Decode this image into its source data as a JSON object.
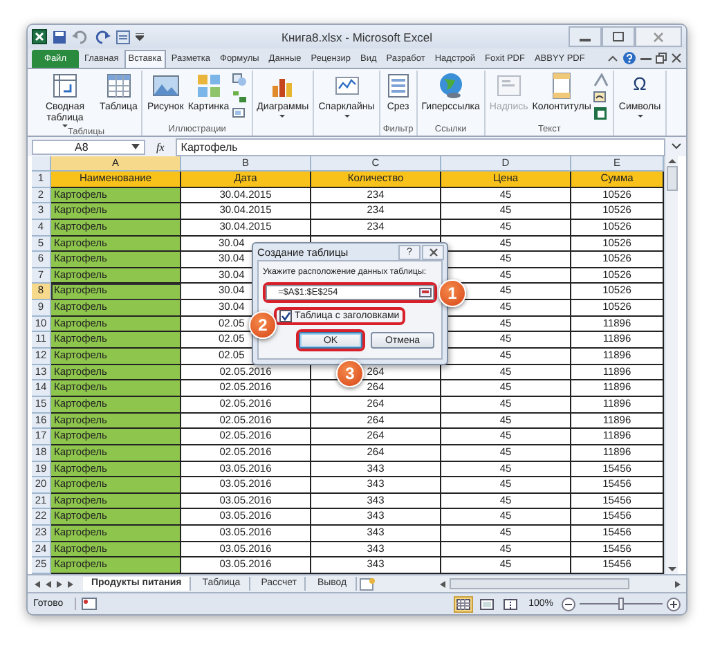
{
  "window": {
    "title": "Книга8.xlsx - Microsoft Excel"
  },
  "ribbon_tabs": [
    {
      "label": "Файл",
      "kind": "file",
      "selected": false
    },
    {
      "label": "Главная",
      "kind": "tab",
      "selected": false
    },
    {
      "label": "Вставка",
      "kind": "tab",
      "selected": true
    },
    {
      "label": "Разметка",
      "kind": "tab",
      "selected": false
    },
    {
      "label": "Формулы",
      "kind": "tab",
      "selected": false
    },
    {
      "label": "Данные",
      "kind": "tab",
      "selected": false
    },
    {
      "label": "Рецензир",
      "kind": "tab",
      "selected": false
    },
    {
      "label": "Вид",
      "kind": "tab",
      "selected": false
    },
    {
      "label": "Разработ",
      "kind": "tab",
      "selected": false
    },
    {
      "label": "Надстрой",
      "kind": "tab",
      "selected": false
    },
    {
      "label": "Foxit PDF",
      "kind": "tab",
      "selected": false
    },
    {
      "label": "ABBYY PDF",
      "kind": "tab",
      "selected": false
    }
  ],
  "ribbon_groups": [
    {
      "label": "Таблицы",
      "buttons": [
        {
          "kind": "large",
          "label": "Сводная таблица",
          "dropdown": true,
          "disabled": false
        },
        {
          "kind": "large",
          "label": "Таблица",
          "dropdown": false,
          "disabled": false
        }
      ]
    },
    {
      "label": "Иллюстрации",
      "buttons": [
        {
          "kind": "large",
          "label": "Рисунок",
          "dropdown": false,
          "disabled": false
        },
        {
          "kind": "large",
          "label": "Картинка",
          "dropdown": false,
          "disabled": false
        },
        {
          "kind": "stack"
        }
      ]
    },
    {
      "buttons": [
        {
          "kind": "large",
          "label": "Диаграммы",
          "dropdown": true,
          "disabled": false
        }
      ]
    },
    {
      "buttons": [
        {
          "kind": "large",
          "label": "Спарклайны",
          "dropdown": true,
          "disabled": false
        }
      ]
    },
    {
      "label": "Фильтр",
      "buttons": [
        {
          "kind": "large",
          "label": "Срез",
          "dropdown": false,
          "disabled": false
        }
      ]
    },
    {
      "label": "Ссылки",
      "buttons": [
        {
          "kind": "large",
          "label": "Гиперссылка",
          "dropdown": false,
          "disabled": false
        }
      ]
    },
    {
      "label": "Текст",
      "buttons": [
        {
          "kind": "large",
          "label": "Надпись",
          "dropdown": false,
          "disabled": true
        },
        {
          "kind": "large",
          "label": "Колонтитулы",
          "dropdown": false,
          "disabled": false
        },
        {
          "kind": "stack"
        }
      ]
    },
    {
      "buttons": [
        {
          "kind": "glyph",
          "label": "Символы",
          "glyph": "Ω",
          "dropdown": true,
          "disabled": false
        }
      ]
    }
  ],
  "formula_bar": {
    "name_box": "A8",
    "function_label": "fx",
    "formula": "Картофель"
  },
  "columns": [
    {
      "label": "A",
      "selected": true
    },
    {
      "label": "B",
      "selected": false
    },
    {
      "label": "C",
      "selected": false
    },
    {
      "label": "D",
      "selected": false
    },
    {
      "label": "E",
      "selected": false
    }
  ],
  "rows": [
    {
      "number": "1",
      "kind": "header",
      "selected": false,
      "cells": [
        {
          "kind": "text",
          "text": "Наименование"
        },
        {
          "kind": "text",
          "text": "Дата"
        },
        {
          "kind": "text",
          "text": "Количество"
        },
        {
          "kind": "text",
          "text": "Цена"
        },
        {
          "kind": "text",
          "text": "Сумма"
        }
      ]
    },
    {
      "number": "2",
      "kind": "data",
      "selected": false,
      "cells": [
        {
          "kind": "text",
          "text": "Картофель"
        },
        {
          "kind": "text",
          "text": "30.04.2015"
        },
        {
          "kind": "text",
          "text": "234"
        },
        {
          "kind": "text",
          "text": "45"
        },
        {
          "kind": "text",
          "text": "10526"
        }
      ]
    },
    {
      "number": "3",
      "kind": "data",
      "selected": false,
      "cells": [
        {
          "kind": "text",
          "text": "Картофель"
        },
        {
          "kind": "text",
          "text": "30.04.2015"
        },
        {
          "kind": "text",
          "text": "234"
        },
        {
          "kind": "text",
          "text": "45"
        },
        {
          "kind": "text",
          "text": "10526"
        }
      ]
    },
    {
      "number": "4",
      "kind": "data",
      "selected": false,
      "cells": [
        {
          "kind": "text",
          "text": "Картофель"
        },
        {
          "kind": "text",
          "text": "30.04.2015"
        },
        {
          "kind": "text",
          "text": "234"
        },
        {
          "kind": "text",
          "text": "45"
        },
        {
          "kind": "text",
          "text": "10526"
        }
      ]
    },
    {
      "number": "5",
      "kind": "data",
      "selected": false,
      "cells": [
        {
          "kind": "text",
          "text": "Картофель"
        },
        {
          "kind": "partial",
          "text": "30.04"
        },
        {
          "kind": "covered"
        },
        {
          "kind": "text",
          "text": "45"
        },
        {
          "kind": "text",
          "text": "10526"
        }
      ]
    },
    {
      "number": "6",
      "kind": "data",
      "selected": false,
      "cells": [
        {
          "kind": "text",
          "text": "Картофель"
        },
        {
          "kind": "partial",
          "text": "30.04"
        },
        {
          "kind": "covered"
        },
        {
          "kind": "text",
          "text": "45"
        },
        {
          "kind": "text",
          "text": "10526"
        }
      ]
    },
    {
      "number": "7",
      "kind": "data",
      "selected": false,
      "cells": [
        {
          "kind": "text",
          "text": "Картофель"
        },
        {
          "kind": "partial",
          "text": "30.04"
        },
        {
          "kind": "covered"
        },
        {
          "kind": "text",
          "text": "45"
        },
        {
          "kind": "text",
          "text": "10526"
        }
      ]
    },
    {
      "number": "8",
      "kind": "data",
      "selected": true,
      "cells": [
        {
          "kind": "text",
          "text": "Картофель"
        },
        {
          "kind": "partial",
          "text": "30.04"
        },
        {
          "kind": "covered"
        },
        {
          "kind": "text",
          "text": "45"
        },
        {
          "kind": "text",
          "text": "10526"
        }
      ]
    },
    {
      "number": "9",
      "kind": "data",
      "selected": false,
      "cells": [
        {
          "kind": "text",
          "text": "Картофель"
        },
        {
          "kind": "partial",
          "text": "30.04"
        },
        {
          "kind": "covered"
        },
        {
          "kind": "text",
          "text": "45"
        },
        {
          "kind": "text",
          "text": "10526"
        }
      ]
    },
    {
      "number": "10",
      "kind": "data",
      "selected": false,
      "cells": [
        {
          "kind": "text",
          "text": "Картофель"
        },
        {
          "kind": "partial",
          "text": "02.05"
        },
        {
          "kind": "covered"
        },
        {
          "kind": "text",
          "text": "45"
        },
        {
          "kind": "text",
          "text": "11896"
        }
      ]
    },
    {
      "number": "11",
      "kind": "data",
      "selected": false,
      "cells": [
        {
          "kind": "text",
          "text": "Картофель"
        },
        {
          "kind": "partial",
          "text": "02.05"
        },
        {
          "kind": "covered"
        },
        {
          "kind": "text",
          "text": "45"
        },
        {
          "kind": "text",
          "text": "11896"
        }
      ]
    },
    {
      "number": "12",
      "kind": "data",
      "selected": false,
      "cells": [
        {
          "kind": "text",
          "text": "Картофель"
        },
        {
          "kind": "partial",
          "text": "02.05"
        },
        {
          "kind": "covered"
        },
        {
          "kind": "text",
          "text": "45"
        },
        {
          "kind": "text",
          "text": "11896"
        }
      ]
    },
    {
      "number": "13",
      "kind": "data",
      "selected": false,
      "cells": [
        {
          "kind": "text",
          "text": "Картофель"
        },
        {
          "kind": "text",
          "text": "02.05.2016"
        },
        {
          "kind": "text",
          "text": "264"
        },
        {
          "kind": "text",
          "text": "45"
        },
        {
          "kind": "text",
          "text": "11896"
        }
      ]
    },
    {
      "number": "14",
      "kind": "data",
      "selected": false,
      "cells": [
        {
          "kind": "text",
          "text": "Картофель"
        },
        {
          "kind": "text",
          "text": "02.05.2016"
        },
        {
          "kind": "text",
          "text": "264"
        },
        {
          "kind": "text",
          "text": "45"
        },
        {
          "kind": "text",
          "text": "11896"
        }
      ]
    },
    {
      "number": "15",
      "kind": "data",
      "selected": false,
      "cells": [
        {
          "kind": "text",
          "text": "Картофель"
        },
        {
          "kind": "text",
          "text": "02.05.2016"
        },
        {
          "kind": "text",
          "text": "264"
        },
        {
          "kind": "text",
          "text": "45"
        },
        {
          "kind": "text",
          "text": "11896"
        }
      ]
    },
    {
      "number": "16",
      "kind": "data",
      "selected": false,
      "cells": [
        {
          "kind": "text",
          "text": "Картофель"
        },
        {
          "kind": "text",
          "text": "02.05.2016"
        },
        {
          "kind": "text",
          "text": "264"
        },
        {
          "kind": "text",
          "text": "45"
        },
        {
          "kind": "text",
          "text": "11896"
        }
      ]
    },
    {
      "number": "17",
      "kind": "data",
      "selected": false,
      "cells": [
        {
          "kind": "text",
          "text": "Картофель"
        },
        {
          "kind": "text",
          "text": "02.05.2016"
        },
        {
          "kind": "text",
          "text": "264"
        },
        {
          "kind": "text",
          "text": "45"
        },
        {
          "kind": "text",
          "text": "11896"
        }
      ]
    },
    {
      "number": "18",
      "kind": "data",
      "selected": false,
      "cells": [
        {
          "kind": "text",
          "text": "Картофель"
        },
        {
          "kind": "text",
          "text": "02.05.2016"
        },
        {
          "kind": "text",
          "text": "264"
        },
        {
          "kind": "text",
          "text": "45"
        },
        {
          "kind": "text",
          "text": "11896"
        }
      ]
    },
    {
      "number": "19",
      "kind": "data",
      "selected": false,
      "cells": [
        {
          "kind": "text",
          "text": "Картофель"
        },
        {
          "kind": "text",
          "text": "03.05.2016"
        },
        {
          "kind": "text",
          "text": "343"
        },
        {
          "kind": "text",
          "text": "45"
        },
        {
          "kind": "text",
          "text": "15456"
        }
      ]
    },
    {
      "number": "20",
      "kind": "data",
      "selected": false,
      "cells": [
        {
          "kind": "text",
          "text": "Картофель"
        },
        {
          "kind": "text",
          "text": "03.05.2016"
        },
        {
          "kind": "text",
          "text": "343"
        },
        {
          "kind": "text",
          "text": "45"
        },
        {
          "kind": "text",
          "text": "15456"
        }
      ]
    },
    {
      "number": "21",
      "kind": "data",
      "selected": false,
      "cells": [
        {
          "kind": "text",
          "text": "Картофель"
        },
        {
          "kind": "text",
          "text": "03.05.2016"
        },
        {
          "kind": "text",
          "text": "343"
        },
        {
          "kind": "text",
          "text": "45"
        },
        {
          "kind": "text",
          "text": "15456"
        }
      ]
    },
    {
      "number": "22",
      "kind": "data",
      "selected": false,
      "cells": [
        {
          "kind": "text",
          "text": "Картофель"
        },
        {
          "kind": "text",
          "text": "03.05.2016"
        },
        {
          "kind": "text",
          "text": "343"
        },
        {
          "kind": "text",
          "text": "45"
        },
        {
          "kind": "text",
          "text": "15456"
        }
      ]
    },
    {
      "number": "23",
      "kind": "data",
      "selected": false,
      "cells": [
        {
          "kind": "text",
          "text": "Картофель"
        },
        {
          "kind": "text",
          "text": "03.05.2016"
        },
        {
          "kind": "text",
          "text": "343"
        },
        {
          "kind": "text",
          "text": "45"
        },
        {
          "kind": "text",
          "text": "15456"
        }
      ]
    },
    {
      "number": "24",
      "kind": "data",
      "selected": false,
      "cells": [
        {
          "kind": "text",
          "text": "Картофель"
        },
        {
          "kind": "text",
          "text": "03.05.2016"
        },
        {
          "kind": "text",
          "text": "343"
        },
        {
          "kind": "text",
          "text": "45"
        },
        {
          "kind": "text",
          "text": "15456"
        }
      ]
    },
    {
      "number": "25",
      "kind": "data",
      "selected": false,
      "cells": [
        {
          "kind": "text",
          "text": "Картофель"
        },
        {
          "kind": "text",
          "text": "03.05.2016"
        },
        {
          "kind": "text",
          "text": "343"
        },
        {
          "kind": "text",
          "text": "45"
        },
        {
          "kind": "text",
          "text": "15456"
        }
      ]
    }
  ],
  "dialog": {
    "title": "Создание таблицы",
    "help": "?",
    "prompt": "Укажите расположение данных таблицы:",
    "range": "=$A$1:$E$254",
    "range_highlighted": true,
    "checkbox": {
      "label": "Таблица с заголовками",
      "checked": true,
      "highlighted": true
    },
    "buttons": [
      {
        "label": "OK",
        "default": true,
        "highlighted": true
      },
      {
        "label": "Отмена",
        "default": false,
        "highlighted": false
      }
    ]
  },
  "callouts": [
    {
      "number": "1"
    },
    {
      "number": "2"
    },
    {
      "number": "3"
    }
  ],
  "sheet_tabs": [
    {
      "label": "Продукты питания",
      "selected": true
    },
    {
      "label": "Таблица",
      "selected": false
    },
    {
      "label": "Рассчет",
      "selected": false
    },
    {
      "label": "Вывод",
      "selected": false
    }
  ],
  "status_bar": {
    "text": "Готово",
    "views": [
      {
        "kind": "normal",
        "selected": true
      },
      {
        "kind": "layout",
        "selected": false
      },
      {
        "kind": "pagebreak",
        "selected": false
      }
    ],
    "zoom": "100%",
    "zoom_slider": {
      "level": 0.5
    }
  }
}
